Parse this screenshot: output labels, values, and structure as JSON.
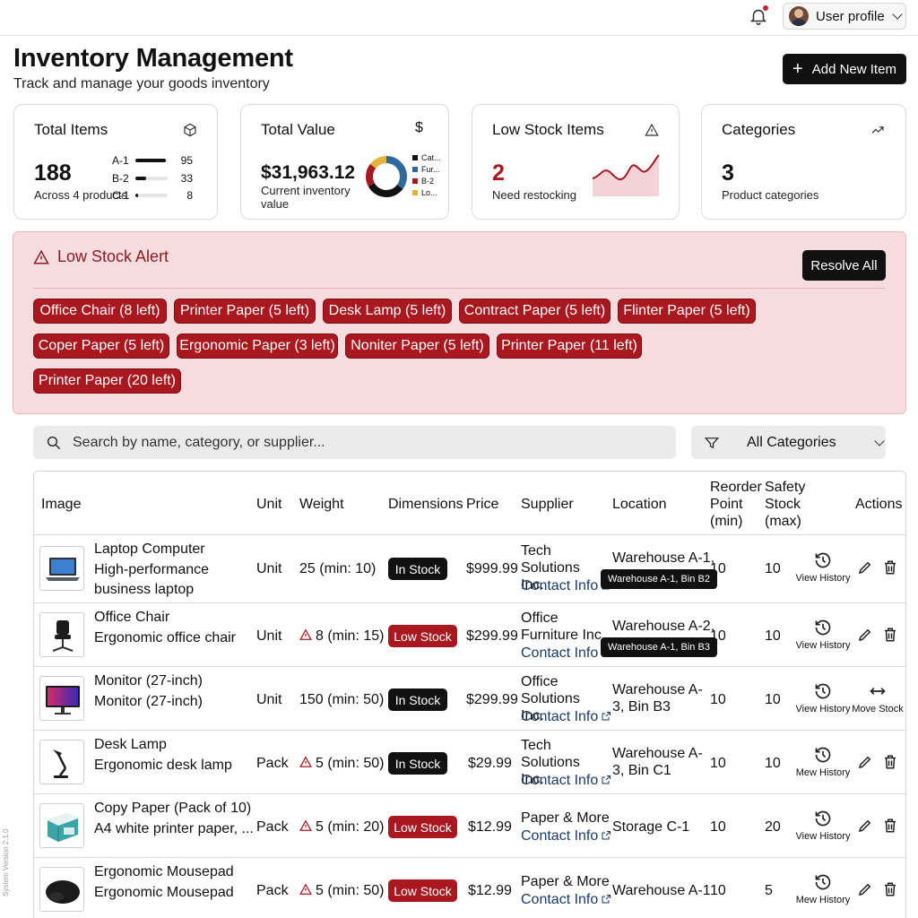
{
  "header": {
    "profile_label": "User profile",
    "title": "Inventory Management",
    "subtitle": "Track and manage your goods inventory",
    "add_button": "Add New Item"
  },
  "stats": {
    "total_items": {
      "title": "Total Items",
      "value": "188",
      "sub": "Across 4 products",
      "breakdown": [
        {
          "label": "A-1",
          "value": "95",
          "fraction": 0.95
        },
        {
          "label": "B-2",
          "value": "33",
          "fraction": 0.33
        },
        {
          "label": "C-1",
          "value": "8",
          "fraction": 0.08
        }
      ]
    },
    "total_value": {
      "title": "Total Value",
      "value": "$31,963.12",
      "sub": "Current inventory value",
      "legend": [
        {
          "label": "Cat...",
          "color": "#111111"
        },
        {
          "label": "Fur...",
          "color": "#2e6a9e"
        },
        {
          "label": "B-2",
          "color": "#a9171f"
        },
        {
          "label": "Lo...",
          "color": "#e2b53a"
        }
      ]
    },
    "low_stock": {
      "title": "Low Stock Items",
      "value": "2",
      "sub": "Need restocking"
    },
    "categories": {
      "title": "Categories",
      "value": "3",
      "sub": "Product categories"
    }
  },
  "alert": {
    "title": "Low Stock Alert",
    "resolve_button": "Resolve All",
    "chips": [
      "Office Chair (8 left)",
      "Printer Paper (5 left)",
      "Desk Lamp (5 left)",
      "Contract Paper (5 left)",
      "Flinter Paper (5 left)",
      "Coper Paper (5 left)",
      "Ergonomic Paper (3 left)",
      "Noniter Paper (5 left)",
      "Printer Paper (11 left)",
      "Printer Paper (20 left)"
    ]
  },
  "search": {
    "placeholder": "Search by name, category, or supplier..."
  },
  "filter": {
    "selected": "All Categories"
  },
  "table": {
    "headers": {
      "image": "Image",
      "unit": "Unit",
      "weight": "Weight",
      "dimensions": "Dimensions",
      "price": "Price",
      "supplier": "Supplier",
      "location": "Location",
      "reorder_point": "Reorder Point (min)",
      "safety_stock": "Safety Stock (max)",
      "actions": "Actions"
    },
    "rows": [
      {
        "name": "Laptop Computer",
        "desc": "High-performance business laptop",
        "unit": "Unit",
        "weight": "25 (min: 10)",
        "warn": false,
        "status": "In Stock",
        "price": "$999.99",
        "supplier": "Tech Solutions Inc.",
        "contact": "Contact Info",
        "location": "Warehouse A-1,",
        "tooltip": "Warehouse A-1, Bin B2",
        "reorder": "10",
        "safety": "10",
        "history": "View History",
        "move": ""
      },
      {
        "name": "Office Chair",
        "desc": "Ergonomic office chair",
        "unit": "Unit",
        "weight": "8 (min: 15)",
        "warn": true,
        "status": "Low Stock",
        "price": "$299.99",
        "supplier": "Office Furniture Inc.",
        "contact": "Contact Info",
        "location": "Warehouse A-2,",
        "tooltip": "Warehouse A-1, Bin B3",
        "reorder": "10",
        "safety": "10",
        "history": "View History",
        "move": ""
      },
      {
        "name": "Monitor (27-inch)",
        "desc": "Monitor (27-inch)",
        "unit": "Unit",
        "weight": "150 (min: 50)",
        "warn": false,
        "status": "In Stock",
        "price": "$299.99",
        "supplier": "Office Solutions Inc.",
        "contact": "Contact Info",
        "location": "Warehouse A-3, Bin B3",
        "tooltip": "",
        "reorder": "10",
        "safety": "10",
        "history": "View History",
        "move": "Move Stock"
      },
      {
        "name": "Desk Lamp",
        "desc": "Ergonomic desk lamp",
        "unit": "Pack",
        "weight": "5 (min: 50)",
        "warn": true,
        "status": "In Stock",
        "price": "$29.99",
        "supplier": "Tech Solutions Inc.",
        "contact": "Contact Info",
        "location": "Warehouse A-3, Bin C1",
        "tooltip": "",
        "reorder": "10",
        "safety": "10",
        "history": "Mew History",
        "move": ""
      },
      {
        "name": "Copy Paper (Pack of 10)",
        "desc": "A4 white printer paper, ...",
        "unit": "Pack",
        "weight": "5 (min: 20)",
        "warn": true,
        "status": "Low Stock",
        "price": "$12.99",
        "supplier": "Paper & More",
        "contact": "Contact Info",
        "location": "Storage C-1",
        "tooltip": "",
        "reorder": "10",
        "safety": "20",
        "history": "View History",
        "move": ""
      },
      {
        "name": "Ergonomic Mousepad",
        "desc": "Ergonomic Mousepad",
        "unit": "Pack",
        "weight": "5 (min: 50)",
        "warn": true,
        "status": "Low Stock",
        "price": "$12.99",
        "supplier": "Paper & More",
        "contact": "Contact Info",
        "location": "Warehouse A-1",
        "tooltip": "",
        "reorder": "10",
        "safety": "5",
        "history": "Mew History",
        "move": ""
      }
    ]
  },
  "footer": {
    "version": "System Version 2.1.0"
  },
  "colors": {
    "accent": "#111111",
    "danger": "#a9171f",
    "alert_bg": "#f6dcde",
    "link": "#1b3a6b"
  }
}
